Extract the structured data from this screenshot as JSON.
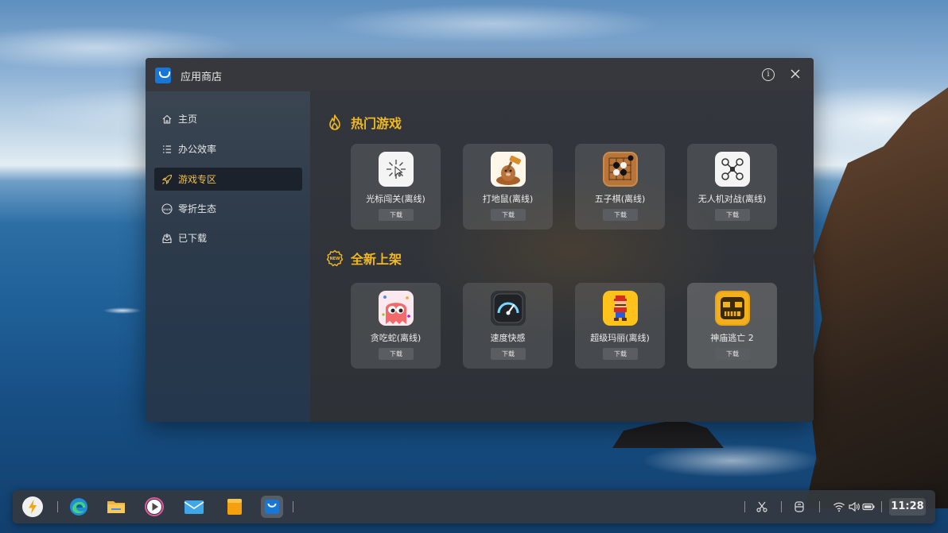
{
  "window": {
    "title": "应用商店"
  },
  "sidebar": {
    "items": [
      {
        "label": "主页",
        "icon": "home-icon"
      },
      {
        "label": "办公效率",
        "icon": "list-icon"
      },
      {
        "label": "游戏专区",
        "icon": "rocket-icon",
        "active": true
      },
      {
        "label": "零折生态",
        "icon": "www-icon"
      },
      {
        "label": "已下载",
        "icon": "download-tray-icon"
      }
    ]
  },
  "sections": [
    {
      "title": "热门游戏",
      "icon": "flame-icon",
      "apps": [
        {
          "name": "光标闯关(离线)",
          "download": "下载",
          "icon": "cursor-app-icon"
        },
        {
          "name": "打地鼠(离线)",
          "download": "下载",
          "icon": "mole-app-icon"
        },
        {
          "name": "五子棋(离线)",
          "download": "下载",
          "icon": "gomoku-app-icon"
        },
        {
          "name": "无人机对战(离线)",
          "download": "下载",
          "icon": "drone-app-icon"
        }
      ]
    },
    {
      "title": "全新上架",
      "icon": "new-badge-icon",
      "badge_text": "NEW",
      "apps": [
        {
          "name": "贪吃蛇(离线)",
          "download": "下载",
          "icon": "snake-app-icon"
        },
        {
          "name": "速度快感",
          "download": "下载",
          "icon": "speedometer-app-icon"
        },
        {
          "name": "超级玛丽(离线)",
          "download": "下载",
          "icon": "mario-app-icon"
        },
        {
          "name": "神庙逃亡 2",
          "download": "下载",
          "icon": "temple-app-icon"
        }
      ]
    }
  ],
  "taskbar": {
    "clock": "11:28",
    "apps": [
      "launcher-icon",
      "edge-browser-icon",
      "file-manager-icon",
      "media-player-icon",
      "mail-icon",
      "notes-icon",
      "app-store-icon"
    ],
    "tray": [
      "screenshot-icon",
      "assistant-icon",
      "wifi-icon",
      "volume-icon",
      "battery-icon"
    ]
  },
  "colors": {
    "accent": "#f2b821",
    "window_bg": "#2b2e33",
    "brand_blue": "#1677d6"
  }
}
